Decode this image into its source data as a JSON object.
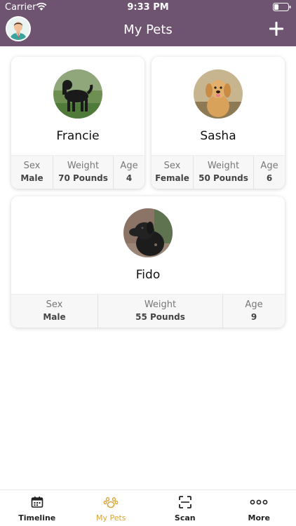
{
  "status_bar": {
    "carrier": "Carrier",
    "time": "9:33 PM"
  },
  "header": {
    "title": "My Pets"
  },
  "pets": [
    {
      "name": "Francie",
      "sex_label": "Sex",
      "sex": "Male",
      "weight_label": "Weight",
      "weight": "70 Pounds",
      "age_label": "Age",
      "age": "4"
    },
    {
      "name": "Sasha",
      "sex_label": "Sex",
      "sex": "Female",
      "weight_label": "Weight",
      "weight": "50 Pounds",
      "age_label": "Age",
      "age": "6"
    },
    {
      "name": "Fido",
      "sex_label": "Sex",
      "sex": "Male",
      "weight_label": "Weight",
      "weight": "55 Pounds",
      "age_label": "Age",
      "age": "9"
    }
  ],
  "tabbar": {
    "items": [
      {
        "label": "Timeline",
        "icon": "calendar-icon"
      },
      {
        "label": "My Pets",
        "icon": "paw-icon",
        "active": true
      },
      {
        "label": "Scan",
        "icon": "scan-icon"
      },
      {
        "label": "More",
        "icon": "more-icon"
      }
    ]
  },
  "colors": {
    "header": "#6e5470",
    "accent": "#d9a637"
  }
}
